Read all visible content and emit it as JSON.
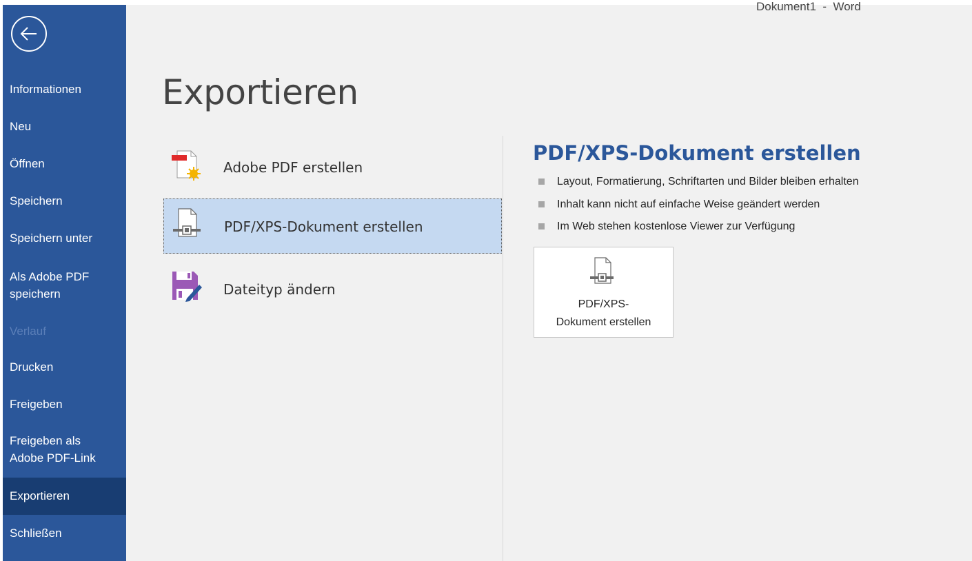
{
  "window": {
    "title": "Dokument1  -  Word"
  },
  "sidebar": {
    "back_icon": "back-arrow-icon",
    "items": [
      {
        "label": "Informationen",
        "state": "normal"
      },
      {
        "label": "Neu",
        "state": "normal"
      },
      {
        "label": "Öffnen",
        "state": "normal"
      },
      {
        "label": "Speichern",
        "state": "normal"
      },
      {
        "label": "Speichern unter",
        "state": "normal"
      },
      {
        "label": "Als Adobe PDF\nspeichern",
        "state": "normal"
      },
      {
        "label": "Verlauf",
        "state": "disabled"
      },
      {
        "label": "Drucken",
        "state": "normal"
      },
      {
        "label": "Freigeben",
        "state": "normal"
      },
      {
        "label": "Freigeben als\nAdobe PDF-Link",
        "state": "normal"
      },
      {
        "label": "Exportieren",
        "state": "active"
      },
      {
        "label": "Schließen",
        "state": "normal"
      }
    ]
  },
  "main": {
    "page_title": "Exportieren",
    "options": [
      {
        "label": "Adobe PDF erstellen",
        "icon": "adobe-pdf-icon",
        "selected": false
      },
      {
        "label": "PDF/XPS-Dokument erstellen",
        "icon": "pdf-xps-document-icon",
        "selected": true
      },
      {
        "label": "Dateityp ändern",
        "icon": "change-file-type-icon",
        "selected": false
      }
    ],
    "detail": {
      "title": "PDF/XPS-Dokument erstellen",
      "bullets": [
        "Layout, Formatierung, Schriftarten und Bilder bleiben erhalten",
        "Inhalt kann nicht auf einfache Weise geändert werden",
        "Im Web stehen kostenlose Viewer zur Verfügung"
      ],
      "button_label": "PDF/XPS-\nDokument erstellen",
      "button_icon": "pdf-xps-document-icon"
    }
  },
  "colors": {
    "sidebar_bg": "#2b579a",
    "sidebar_active": "#183d72",
    "sidebar_disabled_text": "#5b7fb8",
    "accent_title": "#2b579a",
    "selected_option_bg": "#c5d9f1",
    "main_bg": "#f1f1f1"
  }
}
